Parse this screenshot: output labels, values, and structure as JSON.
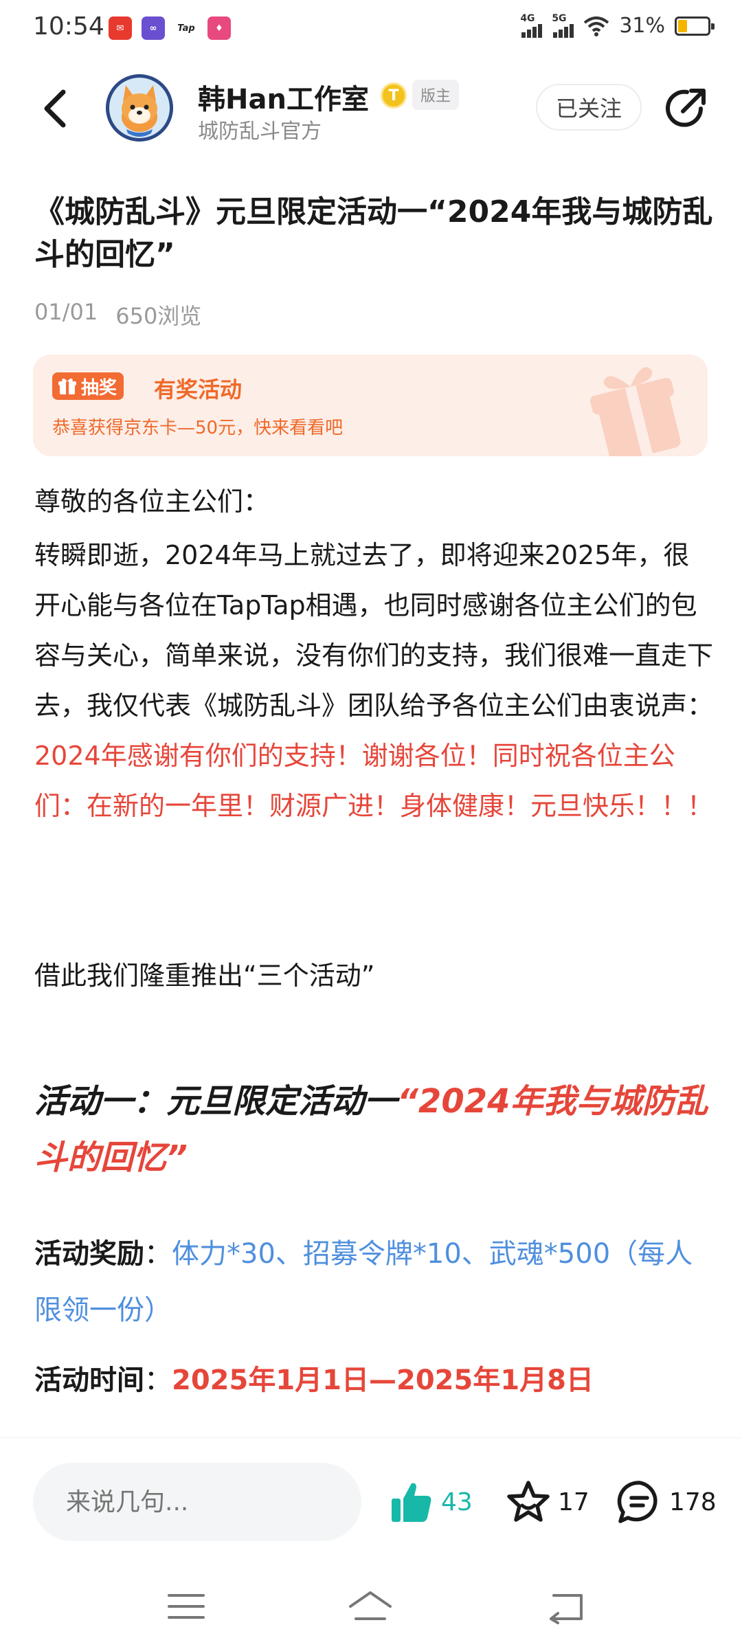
{
  "status_bar": {
    "time": "10:54",
    "apps": [
      {
        "name": "red-app-icon",
        "color": "#e8392f",
        "glyph": "✉"
      },
      {
        "name": "purple-app-icon",
        "color": "#6a4fd0",
        "glyph": "∞"
      },
      {
        "name": "taptap-app-icon",
        "color": "#ffffff",
        "glyph": "Tap"
      },
      {
        "name": "pink-app-icon",
        "color": "#e84a7f",
        "glyph": "♦"
      }
    ],
    "signal1_label": "4G",
    "signal2_label": "5G",
    "battery_text": "31%",
    "battery_level": 0.31
  },
  "header": {
    "author_name": "韩Han工作室",
    "verified_badge": "T",
    "mod_badge": "版主",
    "author_sub": "城防乱斗官方",
    "follow_label": "已关注"
  },
  "post": {
    "title": "《城防乱斗》元旦限定活动一“2024年我与城防乱斗的回忆”",
    "date": "01/01",
    "views": "650浏览",
    "lottery": {
      "tag": "抽奖",
      "title": "有奖活动",
      "subtitle": "恭喜获得京东卡—50元，快来看看吧"
    },
    "greeting": "尊敬的各位主公们：",
    "para_intro": "转瞬即逝，2024年马上就过去了，即将迎来2025年，很开心能与各位在TapTap相遇，也同时感谢各位主公们的包容与关心，简单来说，没有你们的支持，我们很难一直走下去，我仅代表《城防乱斗》团队给予各位主公们由衷说声：",
    "para_red": "2024年感谢有你们的支持！谢谢各位！同时祝各位主公们：在新的一年里！财源广进！身体健康！元旦快乐！！！",
    "para_intro_launch": "借此我们隆重推出“三个活动”",
    "activity_heading_prefix": "活动一：元旦限定活动一",
    "activity_heading_highlight": "“2024年我与城防乱斗的回忆”",
    "reward_label": "活动奖励",
    "reward_value": "体力*30、招募令牌*10、武魂*500（每人限领一份）",
    "time_label": "活动时间",
    "time_value": "2025年1月1日—2025年1月8日",
    "colon": "："
  },
  "bottom_bar": {
    "comment_placeholder": "来说几句...",
    "likes": "43",
    "favorites": "17",
    "comments": "178"
  },
  "colors": {
    "accent_red": "#e6463a",
    "accent_blue": "#4f8fde",
    "like_teal": "#18b8a8",
    "lottery_orange": "#ef6a2a"
  }
}
